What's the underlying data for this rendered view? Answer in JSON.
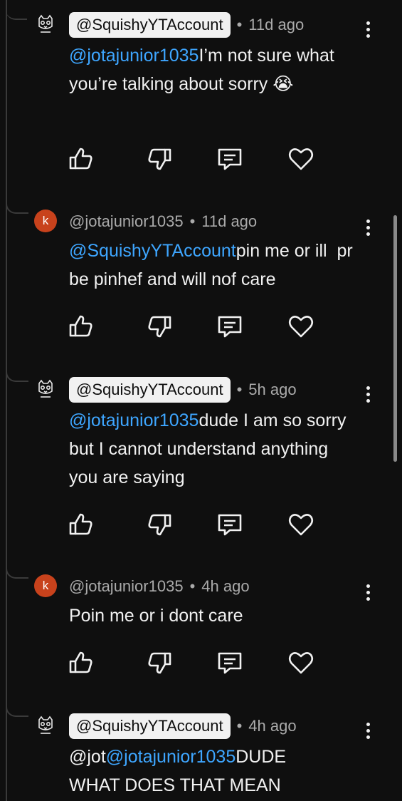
{
  "comments": [
    {
      "author": "@SquishyYTAccount",
      "author_style": "pill",
      "avatar": "cat-outline-icon",
      "time": "11d ago",
      "mention": "@jotajunior1035",
      "text": "I’m not sure what you’re talking about sorry 😭"
    },
    {
      "author": "@jotajunior1035",
      "author_style": "plain",
      "avatar_letter": "k",
      "time": "11d ago",
      "mention": "@SquishyYTAccount",
      "text": "pin me or ill  pr be pinhef and will nof care"
    },
    {
      "author": "@SquishyYTAccount",
      "author_style": "pill",
      "avatar": "cat-outline-icon",
      "time": "5h ago",
      "mention": "@jotajunior1035",
      "text": "dude I am so sorry but I cannot understand anything you are saying"
    },
    {
      "author": "@jotajunior1035",
      "author_style": "plain",
      "avatar_letter": "k",
      "time": "4h ago",
      "mention": "",
      "text": "Poin me or i dont care"
    },
    {
      "author": "@SquishyYTAccount",
      "author_style": "pill",
      "avatar": "cat-outline-icon",
      "time": "4h ago",
      "prefix": "@jot",
      "mention": "@jotajunior1035",
      "text": "DUDE WHAT DOES THAT MEAN"
    }
  ],
  "separator": "•",
  "icons": {
    "like": "thumbs-up-icon",
    "dislike": "thumbs-down-icon",
    "reply": "reply-icon",
    "heart": "heart-icon",
    "more": "more-vertical-icon"
  },
  "colors": {
    "background": "#0f0f0f",
    "text": "#f1f1f1",
    "meta": "#aaaaaa",
    "mention": "#3ea6ff",
    "avatar_k": "#c8421c"
  }
}
